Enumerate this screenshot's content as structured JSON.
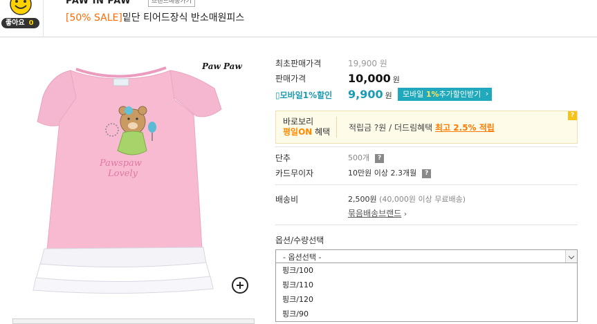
{
  "header": {
    "like_label": "좋아요",
    "like_count": "0",
    "brand_name": "PAW IN PAW",
    "brand_tag": "브랜드배송가기",
    "sale_tag": "[50% SALE]",
    "product_name": "밑단 티어드장식 반소매원피스"
  },
  "image": {
    "brand_logo": "Paw Paw",
    "print_text_1": "Pawspaw",
    "print_text_2": "Lovely"
  },
  "price": {
    "max_label": "최초판매가격",
    "max_value": "19,900 원",
    "sale_label": "판매가격",
    "sale_value": "10,000",
    "currency": "원",
    "mobile_label": "모바일1%할인",
    "mobile_value": "9,900",
    "mobile_button_prefix": "모바일",
    "mobile_button_pct": "1%",
    "mobile_button_suffix": "추가할인받기"
  },
  "benefit": {
    "line1": "바로보리",
    "line2_on": "평일ON",
    "line2_rest": " 혜택",
    "points": "적립금 ?원 / 더드림혜택 ",
    "highlight": "최고 2.5% 적립"
  },
  "details": {
    "unit_label": "단추",
    "unit_value": "500개",
    "card_label": "카드무이자",
    "card_value": "10만원 이상 2.3개월",
    "ship_label": "배송비",
    "ship_value": "2,500원",
    "ship_note": " (40,000원 이상 무료배송)",
    "bundle_link": "묶음배송브랜드"
  },
  "options": {
    "label": "옵션/수량선택",
    "selected": "- 옵션선택 -",
    "items": [
      "핑크/100",
      "핑크/110",
      "핑크/120",
      "핑크/90"
    ]
  },
  "icons": {
    "like": "smiley-icon",
    "zoom": "zoom-in-icon",
    "help": "question-icon",
    "dropdown": "chevron-down-icon"
  },
  "colors": {
    "sale_orange": "#ff6a00",
    "mobile_teal": "#1a9bb4",
    "dress_pink": "#f7b9d0"
  }
}
